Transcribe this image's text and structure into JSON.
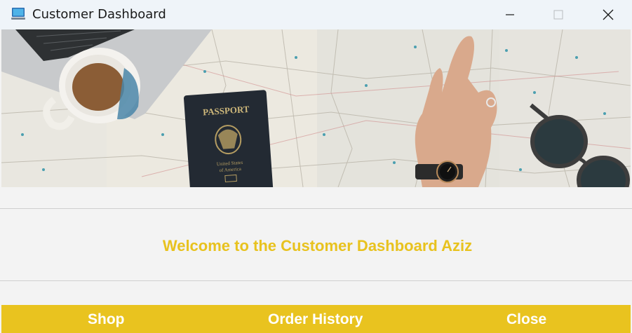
{
  "window": {
    "title": "Customer Dashboard"
  },
  "banner": {
    "passport_title": "PASSPORT",
    "passport_country_line1": "United States",
    "passport_country_line2": "of America"
  },
  "main": {
    "welcome_text": "Welcome to the Customer Dashboard Aziz"
  },
  "footer": {
    "shop_label": "Shop",
    "order_history_label": "Order History",
    "close_label": "Close"
  },
  "colors": {
    "accent": "#e9c31f",
    "welcome_text": "#e8c21e",
    "titlebar": "#eff4f9",
    "background": "#f3f3f3"
  }
}
